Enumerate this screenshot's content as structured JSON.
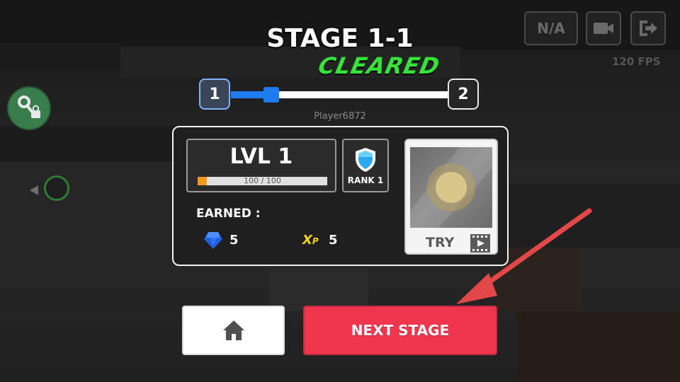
{
  "stage": {
    "title": "STAGE 1-1",
    "status": "CLEARED"
  },
  "progress": {
    "from": "1",
    "to": "2",
    "fraction": 0.2
  },
  "player": {
    "name": "Player6872"
  },
  "level": {
    "label": "LVL 1",
    "xp_text": "100 / 100",
    "xp_fraction": 0.07
  },
  "rank": {
    "label": "RANK 1"
  },
  "earned": {
    "label": "EARNED :",
    "gems": "5",
    "xp_icon_main": "X",
    "xp_icon_sub": "P",
    "xp": "5"
  },
  "reward": {
    "try_label": "TRY"
  },
  "buttons": {
    "next_label": "NEXT STAGE"
  },
  "hud": {
    "na_label": "N/A",
    "fps": "120 FPS"
  },
  "icons": [
    "key-lock-icon",
    "video-camera-icon",
    "exit-icon",
    "home-icon",
    "shield-icon",
    "gem-icon",
    "film-icon",
    "arrow-icon"
  ],
  "colors": {
    "accent_blue": "#1e7cf0",
    "cleared_green": "#35e33a",
    "next_red": "#f0354f",
    "xp_orange": "#f29a1e"
  }
}
